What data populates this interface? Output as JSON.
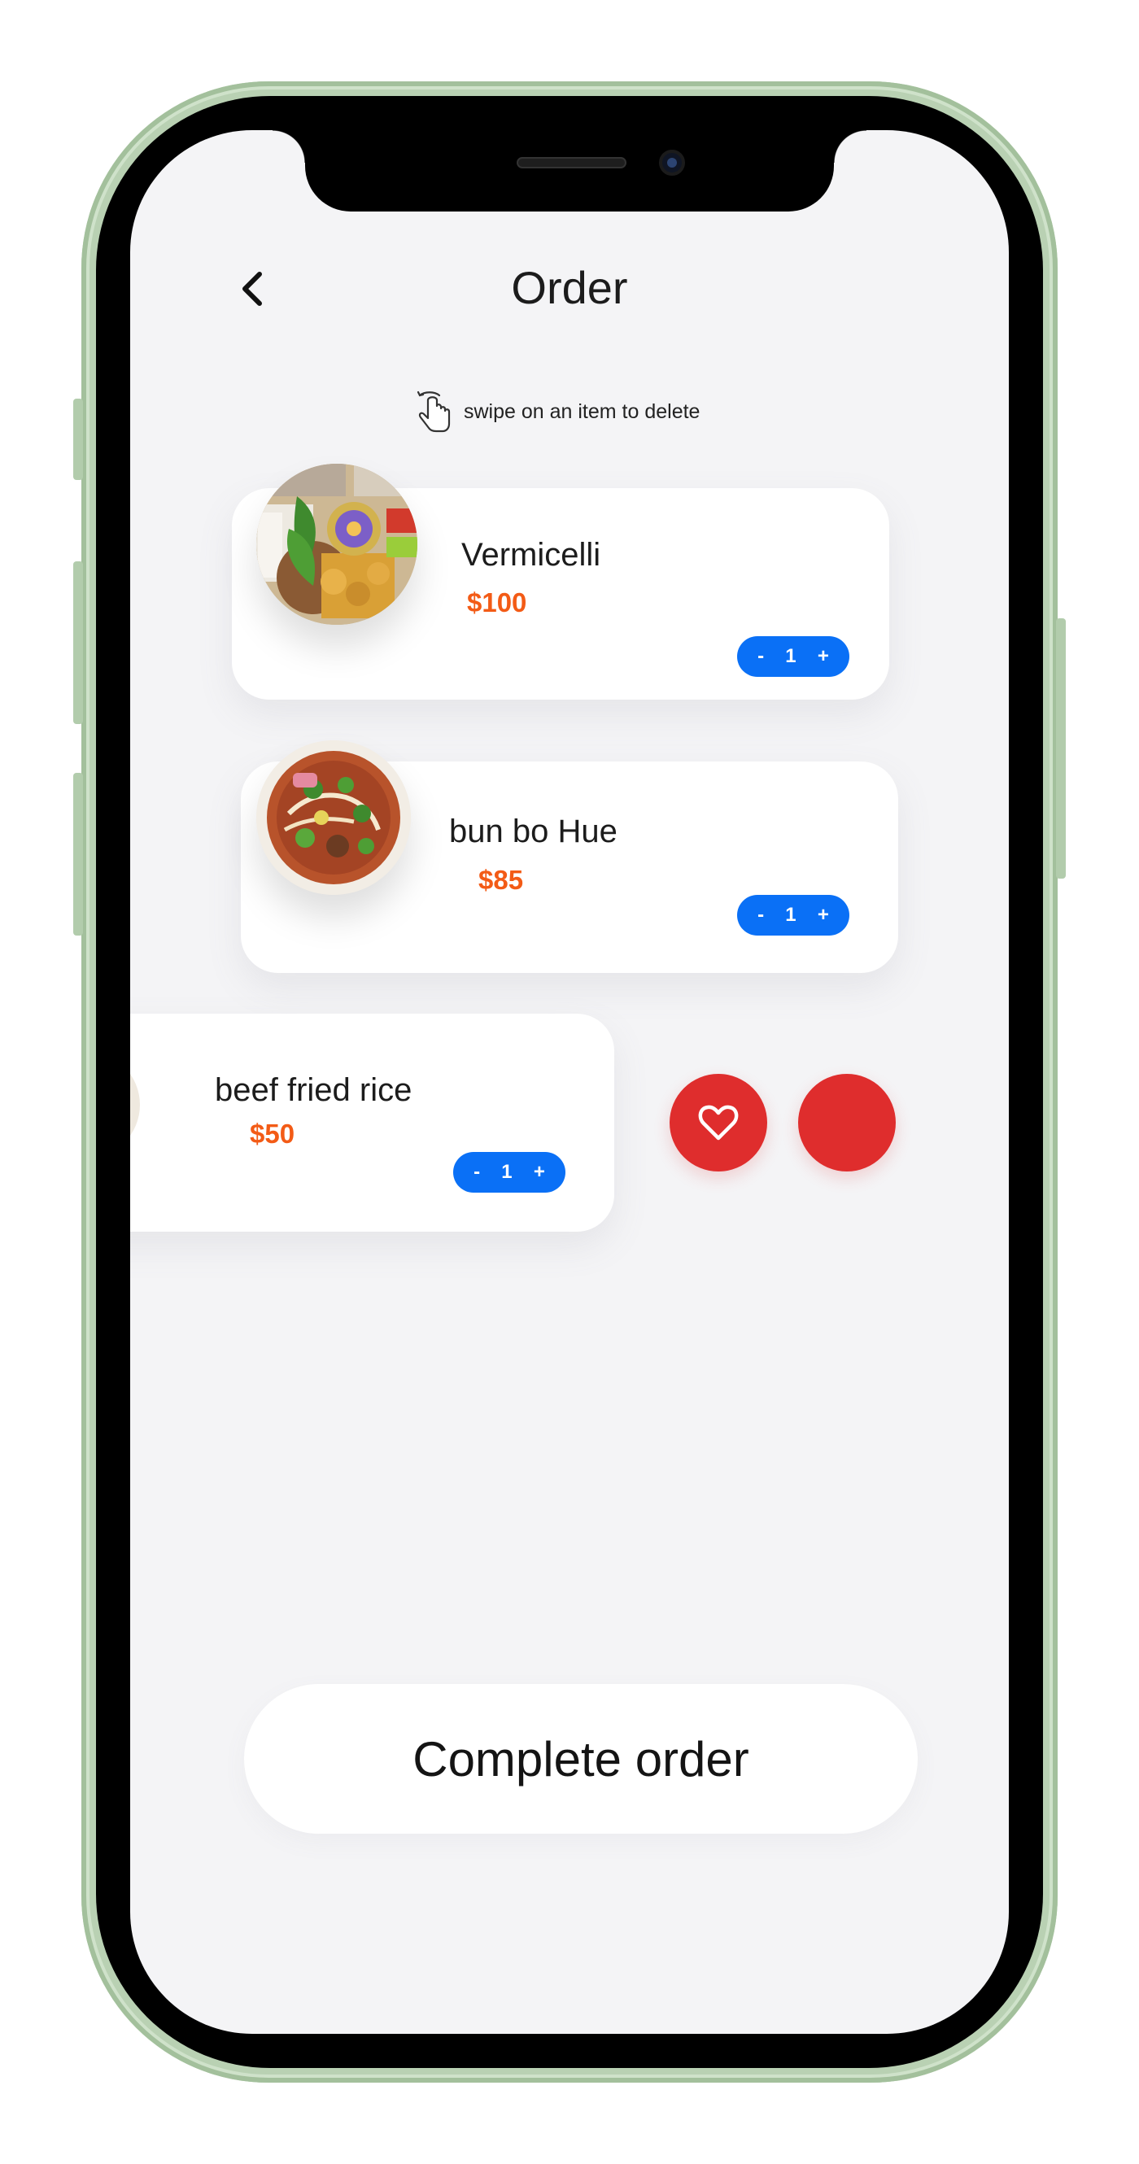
{
  "header": {
    "title": "Order",
    "back_icon": "chevron-left-icon"
  },
  "hint": {
    "icon": "swipe-hand-icon",
    "text": "swipe on an item to delete"
  },
  "order_items": [
    {
      "name": "Vermicelli",
      "price": "$100",
      "qty_minus": "-",
      "quantity": "1",
      "qty_plus": "+"
    },
    {
      "name": "bun bo Hue",
      "price": "$85",
      "qty_minus": "-",
      "quantity": "1",
      "qty_plus": "+"
    },
    {
      "name": "beef fried rice",
      "price": "$50",
      "qty_minus": "-",
      "quantity": "1",
      "qty_plus": "+"
    }
  ],
  "swipe_actions": {
    "favorite_icon": "heart-icon",
    "delete_icon": "",
    "color": "#df2d2d"
  },
  "footer": {
    "complete_label": "Complete order"
  },
  "colors": {
    "accent": "#0a70f6",
    "price": "#f35b16",
    "action": "#df2d2d",
    "background": "#f4f4f6"
  }
}
